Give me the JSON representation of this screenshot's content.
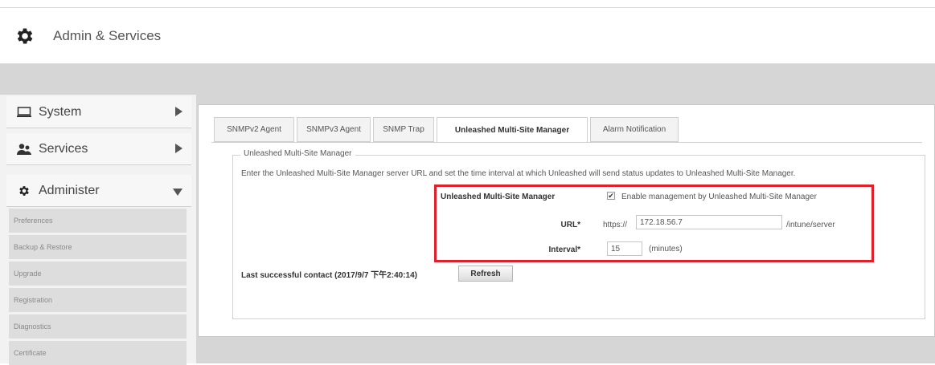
{
  "header": {
    "title": "Admin & Services",
    "icon": "gear-icon"
  },
  "sidebar": {
    "system": {
      "label": "System",
      "icon": "monitor-icon"
    },
    "services": {
      "label": "Services",
      "icon": "users-icon"
    },
    "administer": {
      "label": "Administer",
      "icon": "gear-icon",
      "items": [
        {
          "label": "Preferences"
        },
        {
          "label": "Backup & Restore"
        },
        {
          "label": "Upgrade"
        },
        {
          "label": "Registration"
        },
        {
          "label": "Diagnostics"
        },
        {
          "label": "Certificate"
        }
      ]
    }
  },
  "tabs": [
    {
      "label": "SNMPv2 Agent",
      "active": false
    },
    {
      "label": "SNMPv3 Agent",
      "active": false
    },
    {
      "label": "SNMP Trap",
      "active": false
    },
    {
      "label": "Unleashed Multi-Site Manager",
      "active": true
    },
    {
      "label": "Alarm Notification",
      "active": false
    }
  ],
  "section": {
    "legend": "Unleashed Multi-Site Manager",
    "description": "Enter the Unleashed Multi-Site Manager server URL and set the time interval at which Unleashed will send status updates to Unleashed Multi-Site Manager.",
    "enable_label": "Unleashed Multi-Site Manager",
    "enable_checkbox_label": "Enable management by Unleashed Multi-Site Manager",
    "enable_checked": true,
    "url_label": "URL*",
    "url_prefix": "https://",
    "url_value": "172.18.56.7",
    "url_suffix": "/intune/server",
    "interval_label": "Interval*",
    "interval_value": "15",
    "interval_unit": "(minutes)",
    "last_contact": "Last successful contact (2017/9/7 下午2:40:14)",
    "refresh_label": "Refresh"
  },
  "colors": {
    "highlight": "#e0202a",
    "band": "#d6d6d6"
  }
}
